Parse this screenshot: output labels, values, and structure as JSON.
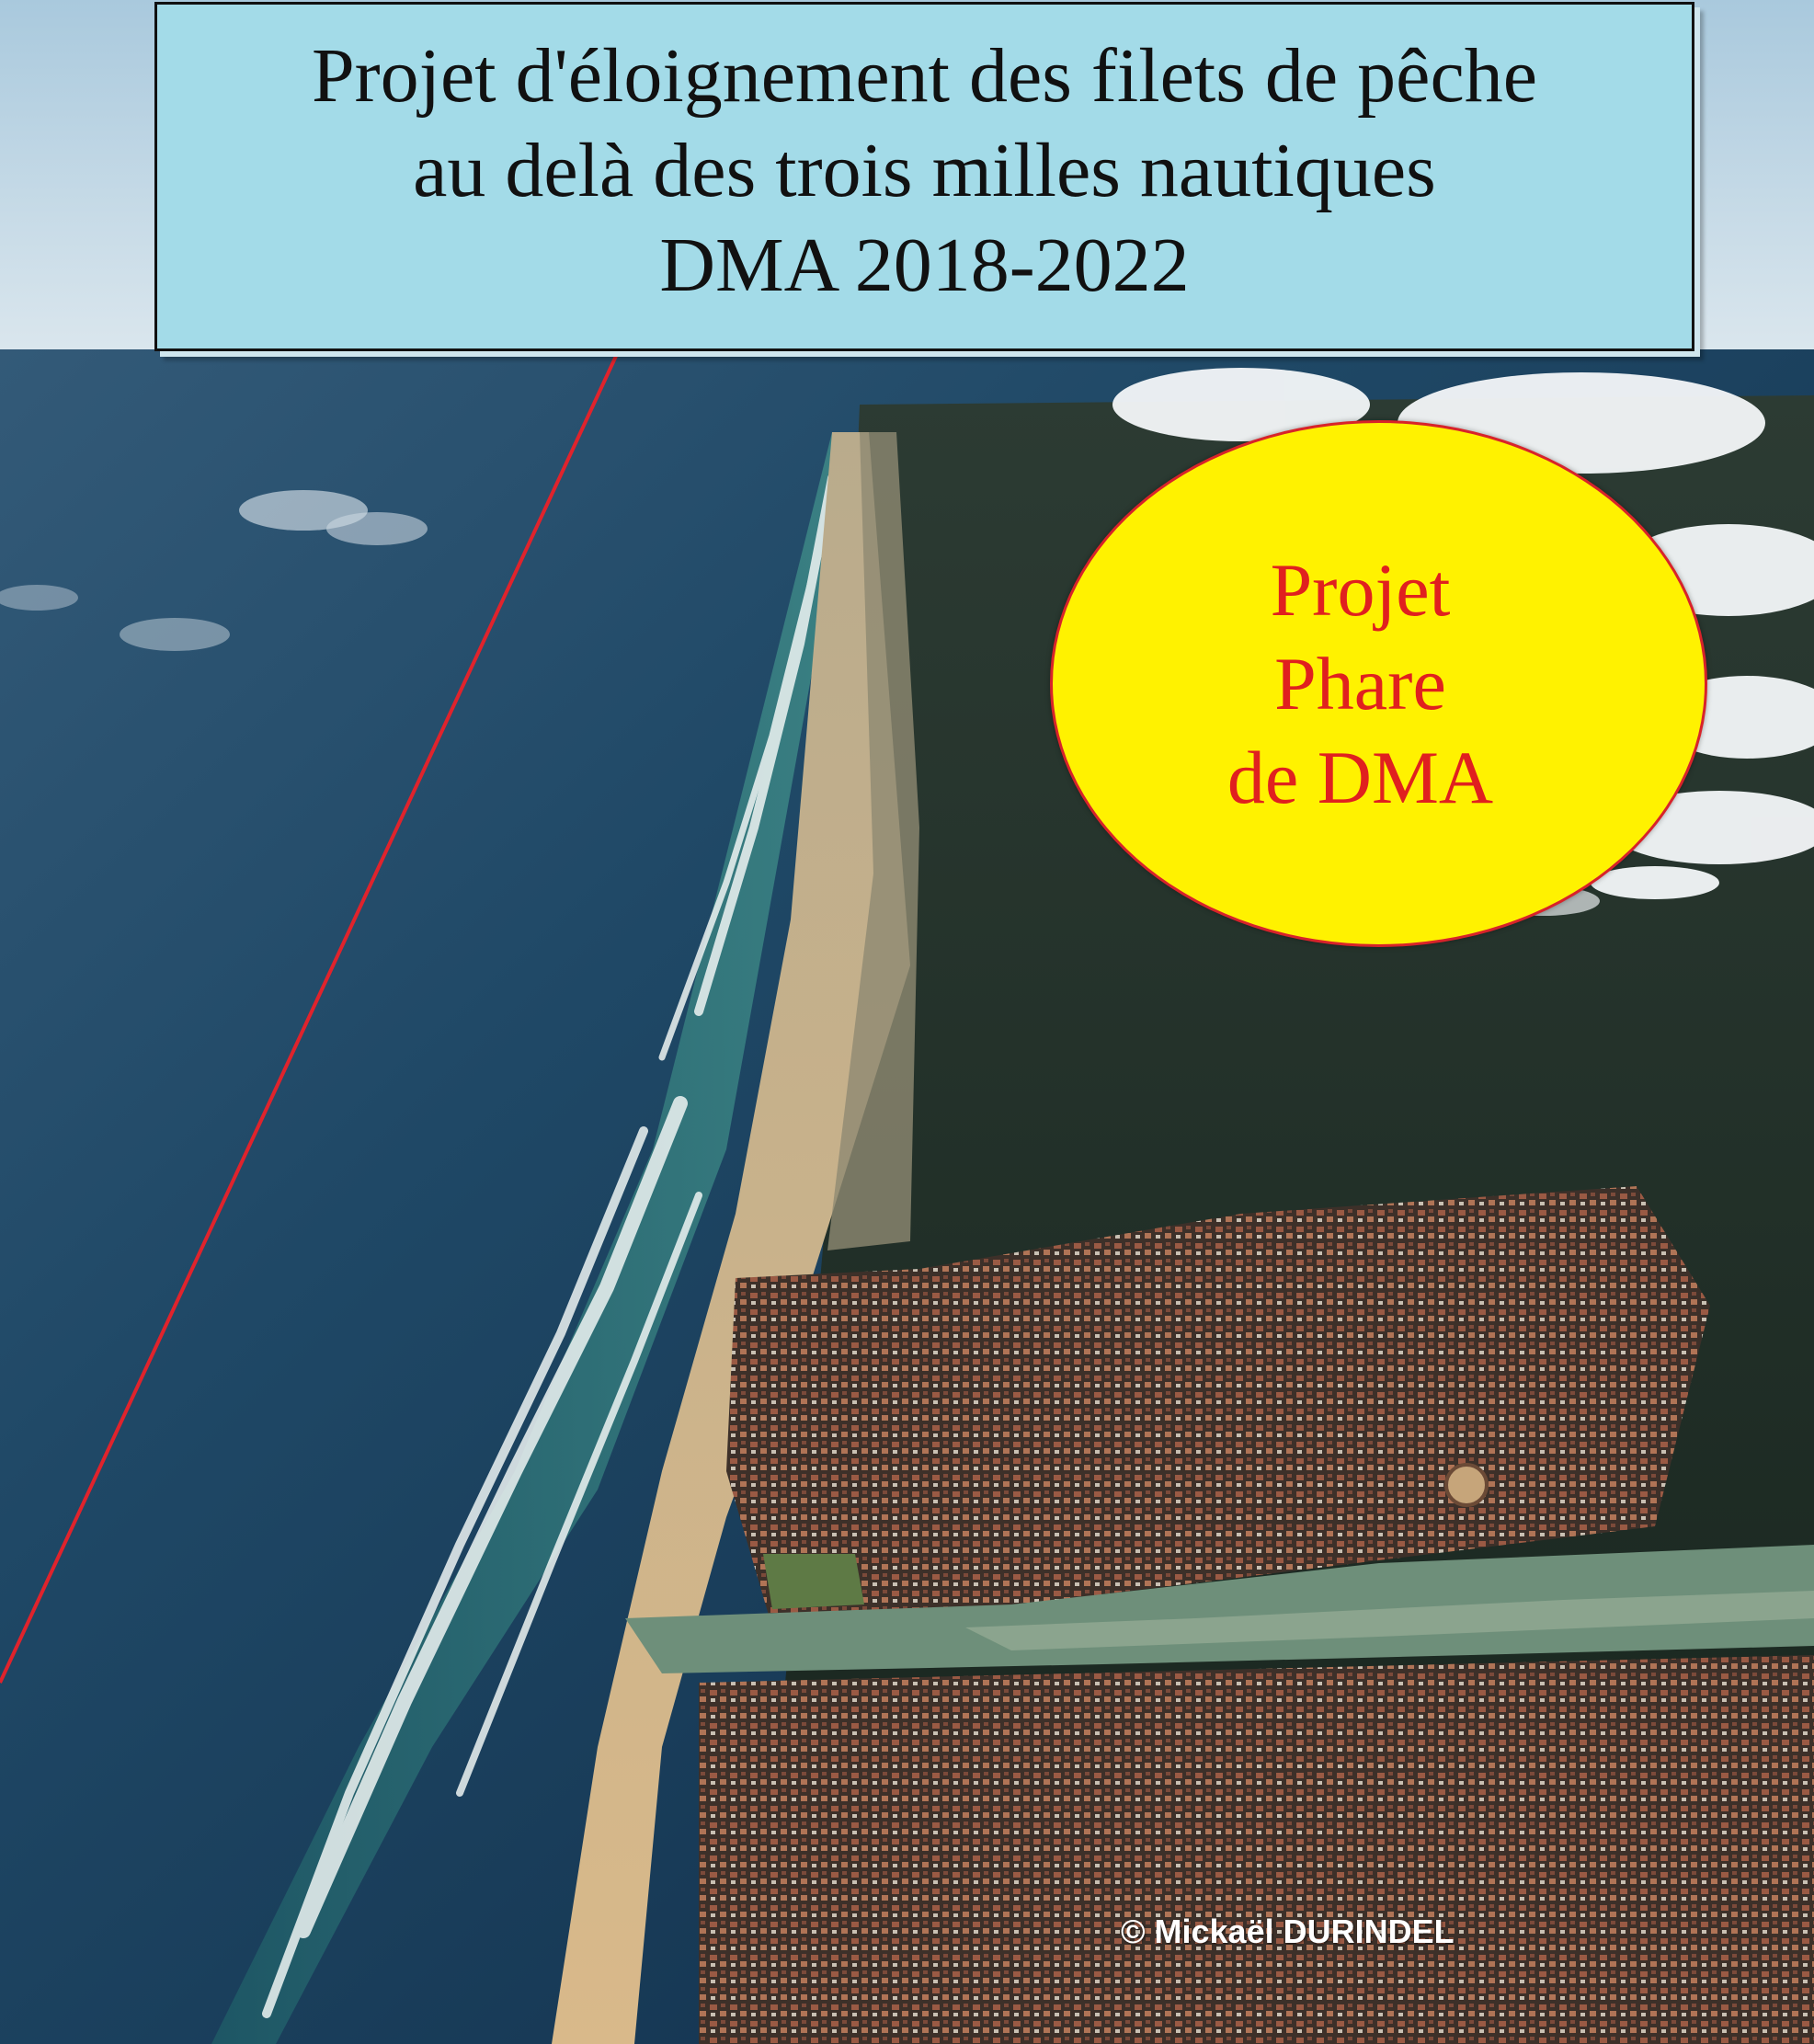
{
  "title_box": {
    "lines": [
      "Projet d'éloignement des filets de pêche",
      "au delà des trois milles nautiques",
      "DMA 2018-2022"
    ]
  },
  "badge": {
    "lines": [
      "Projet",
      "Phare",
      "de DMA"
    ]
  },
  "credit": "© Mickaël DURINDEL",
  "colors": {
    "title_box_fill": "#a3dbe8",
    "badge_fill": "#fff200",
    "badge_text": "#e0201f",
    "pointer_line": "#e0232c"
  },
  "photo": {
    "subject": "aerial-coastline"
  }
}
